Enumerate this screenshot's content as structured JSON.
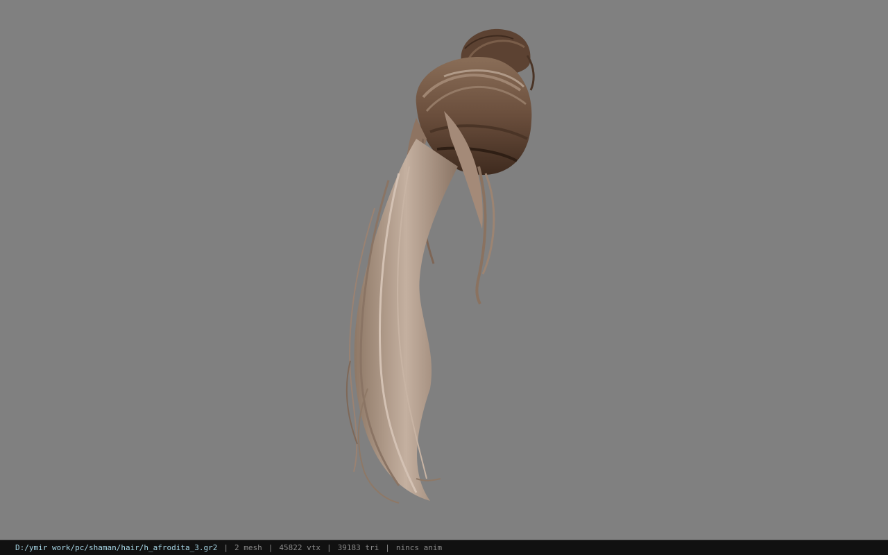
{
  "viewport": {
    "background_color": "#808080",
    "model_name": "hair-model"
  },
  "statusbar": {
    "file_path": "D:/ymir work/pc/shaman/hair/h_afrodita_3.gr2",
    "separator": "|",
    "mesh_count": "2 mesh",
    "vertex_count": "45822 vtx",
    "triangle_count": "39183 tri",
    "anim_status": "nincs anim"
  },
  "colors": {
    "path_text": "#a8d8e8",
    "stat_text": "#8a8a8a",
    "statusbar_bg": "#111111"
  }
}
